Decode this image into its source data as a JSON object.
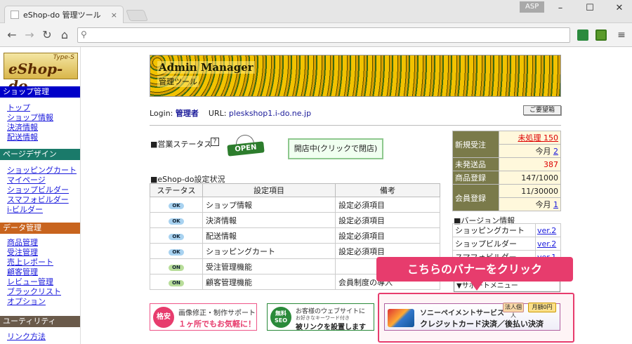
{
  "browser": {
    "tab_title": "eShop-do 管理ツール",
    "tab_close": "×",
    "asp_label": "ASP",
    "address_value": "",
    "icons": [
      "back-icon",
      "forward-icon",
      "reload-icon",
      "home-icon",
      "search-icon",
      "extension-icon",
      "menu-icon"
    ]
  },
  "sidebar": {
    "logo_type": "Type-S",
    "logo_name": "eShop-do",
    "sections": [
      {
        "title": "ショップ管理",
        "color": "#0000c8",
        "items": [
          "トップ",
          "ショップ情報",
          "決済情報",
          "配送情報"
        ]
      },
      {
        "title": "ページデザイン",
        "color": "#1a7a6a",
        "items": [
          "ショッピングカート",
          "マイページ",
          "ショップビルダー",
          "スマフォビルダー",
          "i-ビルダー"
        ]
      },
      {
        "title": "データ管理",
        "color": "#c8641e",
        "items": [
          "商品管理",
          "受注管理",
          "売上レポート",
          "顧客管理",
          "レビュー管理",
          "ブラックリスト",
          "オプション"
        ]
      },
      {
        "title": "ユーティリティ",
        "color": "#6a5a4a",
        "items": [
          "リンク方法"
        ]
      }
    ]
  },
  "header": {
    "title": "Admin Manager",
    "subtitle": "管理ツール"
  },
  "info": {
    "login_label": "Login:",
    "login_value": "管理者",
    "url_label": "URL:",
    "url_value": "pleskshop1.i-do.ne.jp",
    "request_button": "ご要望箱"
  },
  "status": {
    "label": "■営業ステータス",
    "help": "?",
    "sign": "OPEN",
    "toggle_button": "開店中(クリックで閉店)"
  },
  "config": {
    "label": "■eShop-do設定状況",
    "headers": [
      "ステータス",
      "設定項目",
      "備考"
    ],
    "rows": [
      {
        "status": "OK",
        "item": "ショップ情報",
        "note": "設定必須項目"
      },
      {
        "status": "OK",
        "item": "決済情報",
        "note": "設定必須項目"
      },
      {
        "status": "OK",
        "item": "配送情報",
        "note": "設定必須項目"
      },
      {
        "status": "OK",
        "item": "ショッピングカート",
        "note": "設定必須項目"
      },
      {
        "status": "ON",
        "item": "受注管理機能",
        "note": ""
      },
      {
        "status": "ON",
        "item": "顧客管理機能",
        "note": "会員制度の導入"
      }
    ]
  },
  "stats": {
    "new_orders_label": "新規受注",
    "unprocessed": "未処理 150",
    "today_label": "今月",
    "today_value": "2",
    "unshipped_label": "未発送品",
    "unshipped_value": "387",
    "products_label": "商品登録",
    "products_value": "147/1000",
    "members_label": "会員登録",
    "members_value": "11/30000",
    "members_month_label": "今月",
    "members_month_value": "1"
  },
  "versions": {
    "label": "■バージョン情報",
    "rows": [
      {
        "name": "ショッピングカート",
        "ver": "ver.2"
      },
      {
        "name": "ショップビルダー",
        "ver": "ver.2"
      },
      {
        "name": "スマフォビルダー",
        "ver": "ver.1"
      }
    ],
    "select_value": "▼サポートメニュー"
  },
  "callout": {
    "text": "こちらのバナーをクリック"
  },
  "banners": {
    "b1_circle": "格安",
    "b1_line1": "画像修正・制作サポート",
    "b1_line2": "１ヶ所でもお気軽に！",
    "b2_circle": "無料SEO",
    "b2_line1": "お客様のウェブサイトに",
    "b2_small": "お好きなキーワード付き",
    "b2_line2": "被リンクを設置します",
    "pay_line1": "ソニーペイメントサービス",
    "pay_line2": "クレジットカード決済／後払い決済",
    "pay_badge1": "法人個人",
    "pay_badge2": "月額0円"
  }
}
